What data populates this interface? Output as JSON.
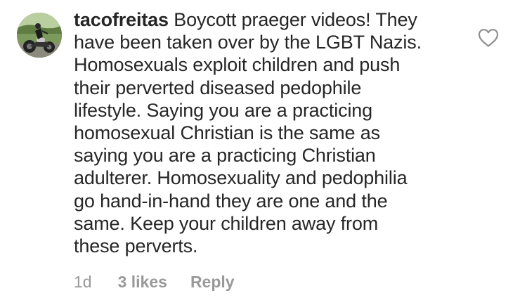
{
  "comment": {
    "username": "tacofreitas",
    "text": "Boycott praeger videos! They\nhave been taken over by the LGBT Nazis.\nHomosexuals exploit children and push\ntheir perverted diseased pedophile\nlifestyle. Saying you are a practicing\nhomosexual Christian is the same as\nsaying you are a practicing Christian\nadulterer. Homosexuality and pedophilia\ngo hand-in-hand they are one and the\nsame. Keep your children away from\nthese perverts.",
    "time_ago": "1d",
    "likes": "3 likes",
    "reply_label": "Reply",
    "avatar_icon": "avatar-motorcycle-rider",
    "like_icon": "heart-outline-icon"
  },
  "colors": {
    "text": "#262626",
    "meta": "#999999",
    "icon": "#8e8e8e"
  }
}
